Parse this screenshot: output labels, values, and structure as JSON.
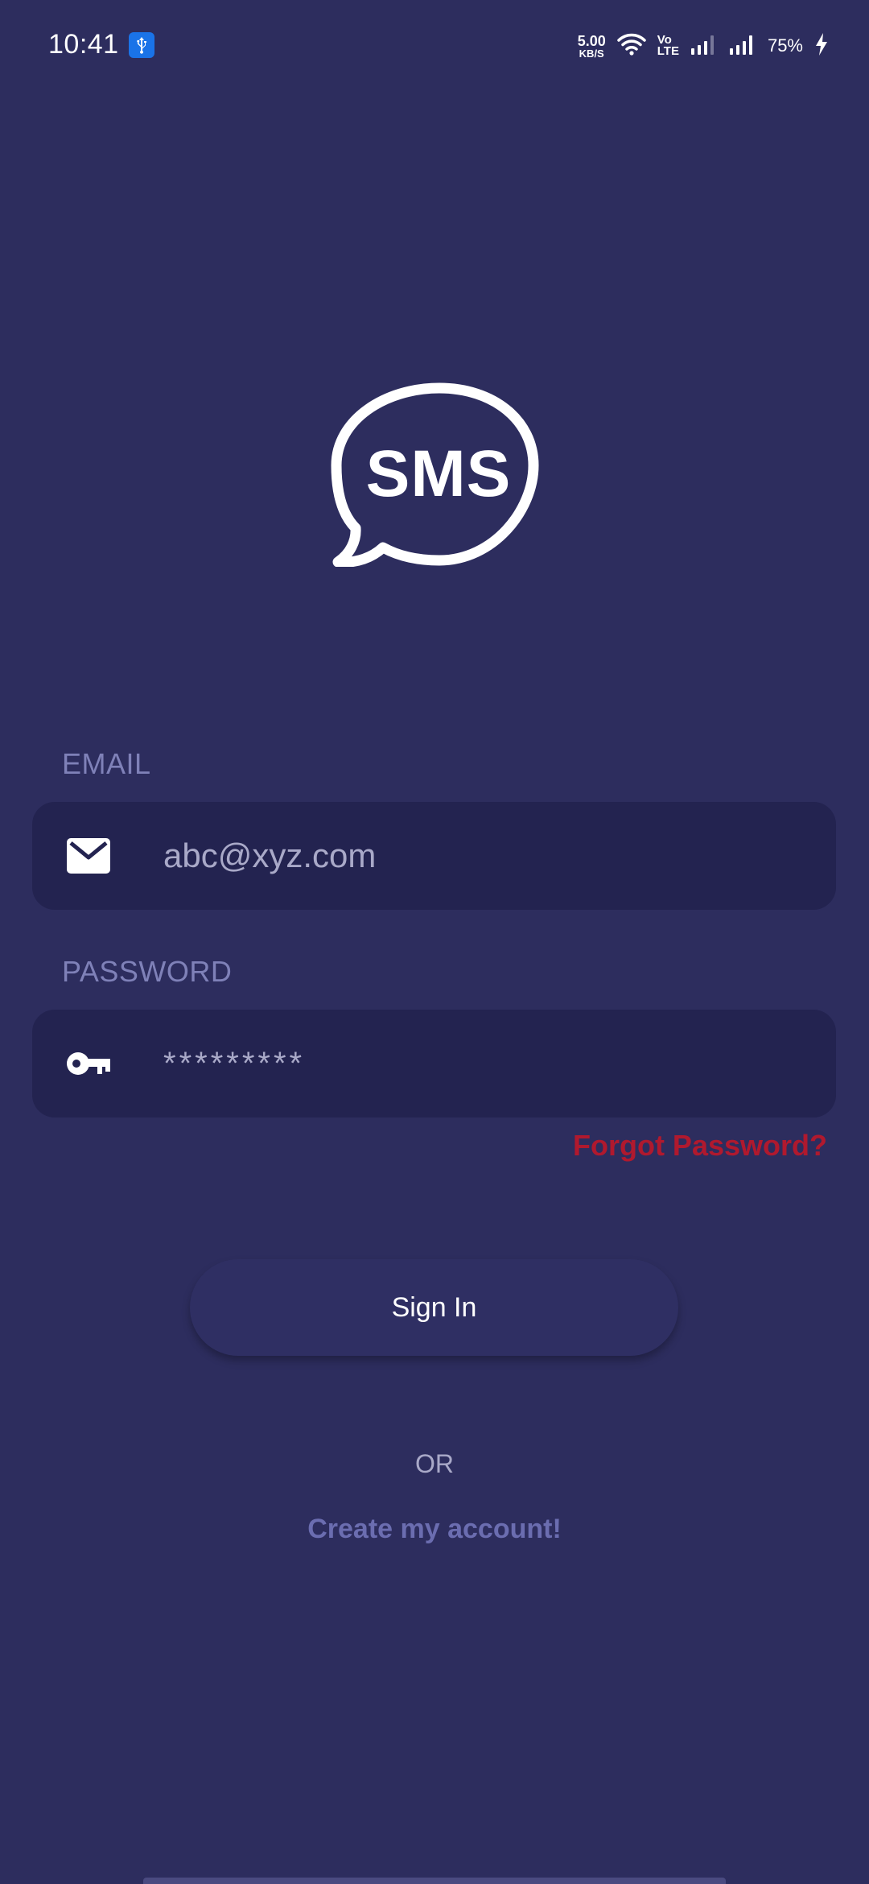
{
  "status_bar": {
    "time": "10:41",
    "net_speed_value": "5.00",
    "net_speed_unit": "KB/S",
    "volte_top": "Vo",
    "volte_bottom": "LTE",
    "battery": "75%",
    "icons": [
      "usb-icon",
      "wifi-icon",
      "signal-icon",
      "signal-icon",
      "charging-icon"
    ]
  },
  "logo": {
    "text": "SMS"
  },
  "form": {
    "email_label": "EMAIL",
    "email_placeholder": "abc@xyz.com",
    "password_label": "PASSWORD",
    "password_value": "*********",
    "forgot_label": "Forgot Password?"
  },
  "actions": {
    "sign_in_label": "Sign In",
    "or_label": "OR",
    "create_label": "Create my account!"
  },
  "colors": {
    "background": "#2d2d5e",
    "field_bg": "#232350",
    "label": "#7f81b8",
    "forgot": "#b0192e",
    "create_link": "#6b6db0"
  }
}
